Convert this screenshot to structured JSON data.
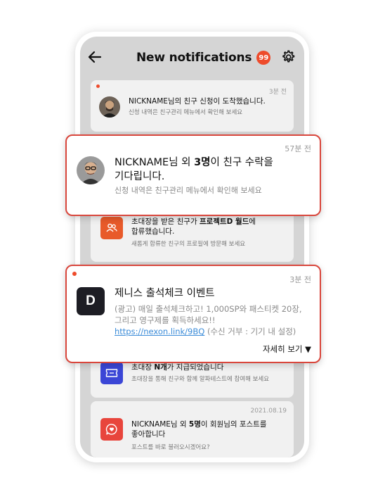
{
  "app": {
    "title": "New notifications",
    "badge_count": "99"
  },
  "notifications": [
    {
      "time": "3분 전",
      "title_parts": [
        "NICKNAME님의 친구 신청이 도착했습니다."
      ],
      "subtitle": "신청 내역은 친구관리 메뉴에서 확인해 보세요",
      "unread": true,
      "icon": "user-avatar"
    },
    {
      "time": "57분 전",
      "title_parts": [
        "NICKNAME님 외 ",
        "3명",
        "이 친구 수락을",
        "기다립니다."
      ],
      "subtitle": "신청 내역은 친구관리 메뉴에서 확인해 보세요",
      "unread": false,
      "icon": "user-avatar"
    },
    {
      "time": "",
      "title_parts": [
        "초대장을 받은 친구가 ",
        "프로젝트D 월드",
        "에",
        "합류했습니다."
      ],
      "subtitle": "새롭게 합류한 친구의 프로필에 방문해 보세요",
      "unread": false,
      "icon": "group-icon",
      "icon_color": "#e85a2a"
    },
    {
      "time": "3분 전",
      "title": "제니스 출석체크 이벤트",
      "body_line1": "(광고) 매일 출석체크하고! 1,000SP와 패스티켓 20장,",
      "body_line2": "그리고 영구제를 획득하세요!!",
      "link": "https://nexon.link/9BQ",
      "link_suffix": " (수신 거부 : 기기 내 설정)",
      "more_label": "자세히 보기 ▼",
      "unread": true,
      "icon": "d-logo",
      "icon_letter": "D",
      "icon_color": "#1d1d24"
    },
    {
      "time": "",
      "title_parts": [
        "초대장 ",
        "N개",
        "가 지급되었습니다"
      ],
      "subtitle": "초대장을 통해 친구와 함께 알파테스트에 참여해 보세요",
      "unread": false,
      "icon": "ticket-icon",
      "icon_color": "#3b46d6"
    },
    {
      "time": "2021.08.19",
      "title_parts": [
        "NICKNAME님 외 ",
        "5명",
        "이 회원님의 포스트를",
        "좋아합니다"
      ],
      "subtitle": "포스트를 바로 불러오시겠어요?",
      "unread": false,
      "icon": "heart-chat-icon",
      "icon_color": "#e8453c"
    }
  ],
  "colors": {
    "accent": "#ee4b2b",
    "popup_border": "#d9463c",
    "screen_bg": "#d5d5d5",
    "card_bg": "#f1f1f1",
    "link": "#3a8bd8"
  }
}
